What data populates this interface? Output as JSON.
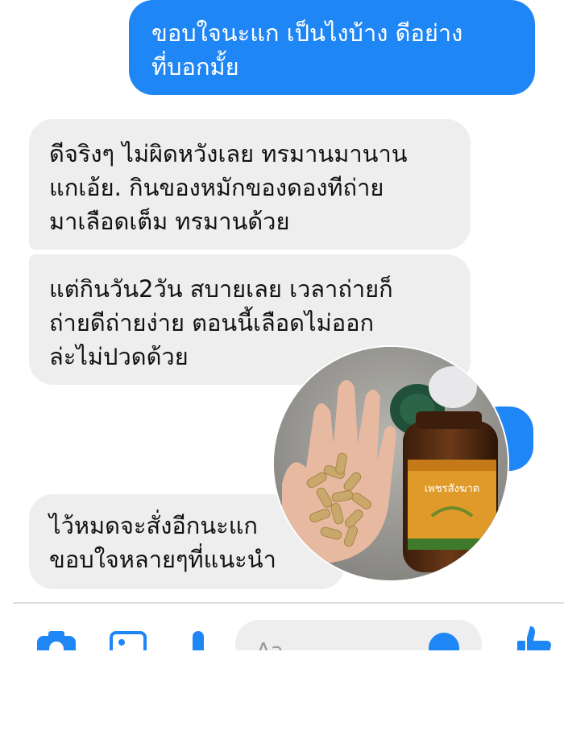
{
  "messages": [
    {
      "direction": "outgoing",
      "lines": [
        "ขอบใจนะแก เป็นไงบ้าง ดีอย่าง",
        "ที่บอกมั้ย"
      ]
    },
    {
      "direction": "incoming",
      "lines": [
        "ดีจริงๆ ไม่ผิดหวังเลย ทรมานมานาน",
        "แกเอ้ย. กินของหมักของดองทีถ่าย",
        "มาเลือดเต็ม ทรมานด้วย"
      ]
    },
    {
      "direction": "incoming",
      "lines": [
        "แต่กินวัน2วัน สบายเลย เวลาถ่ายก็",
        "ถ่ายดีถ่ายง่าย  ตอนนี้เลือดไม่ออก",
        "ล่ะไม่ปวดด้วย"
      ]
    },
    {
      "direction": "incoming",
      "lines": [
        "ไว้หมดจะสั่งอีกนะแก",
        "ขอบใจหลายๆที่แนะนำ"
      ]
    }
  ],
  "photo": {
    "product_label": "เพชรสังฆาต",
    "alt_subject": "hand holding herbal capsules next to product bottle"
  },
  "composer": {
    "placeholder": "Aa",
    "icons": [
      "camera-icon",
      "image-icon",
      "mic-icon",
      "emoji-icon",
      "thumbs-up-icon"
    ]
  },
  "colors": {
    "outgoing_bubble": "#1f86f5",
    "incoming_bubble": "#eeeeee",
    "accent": "#1f86f5"
  }
}
